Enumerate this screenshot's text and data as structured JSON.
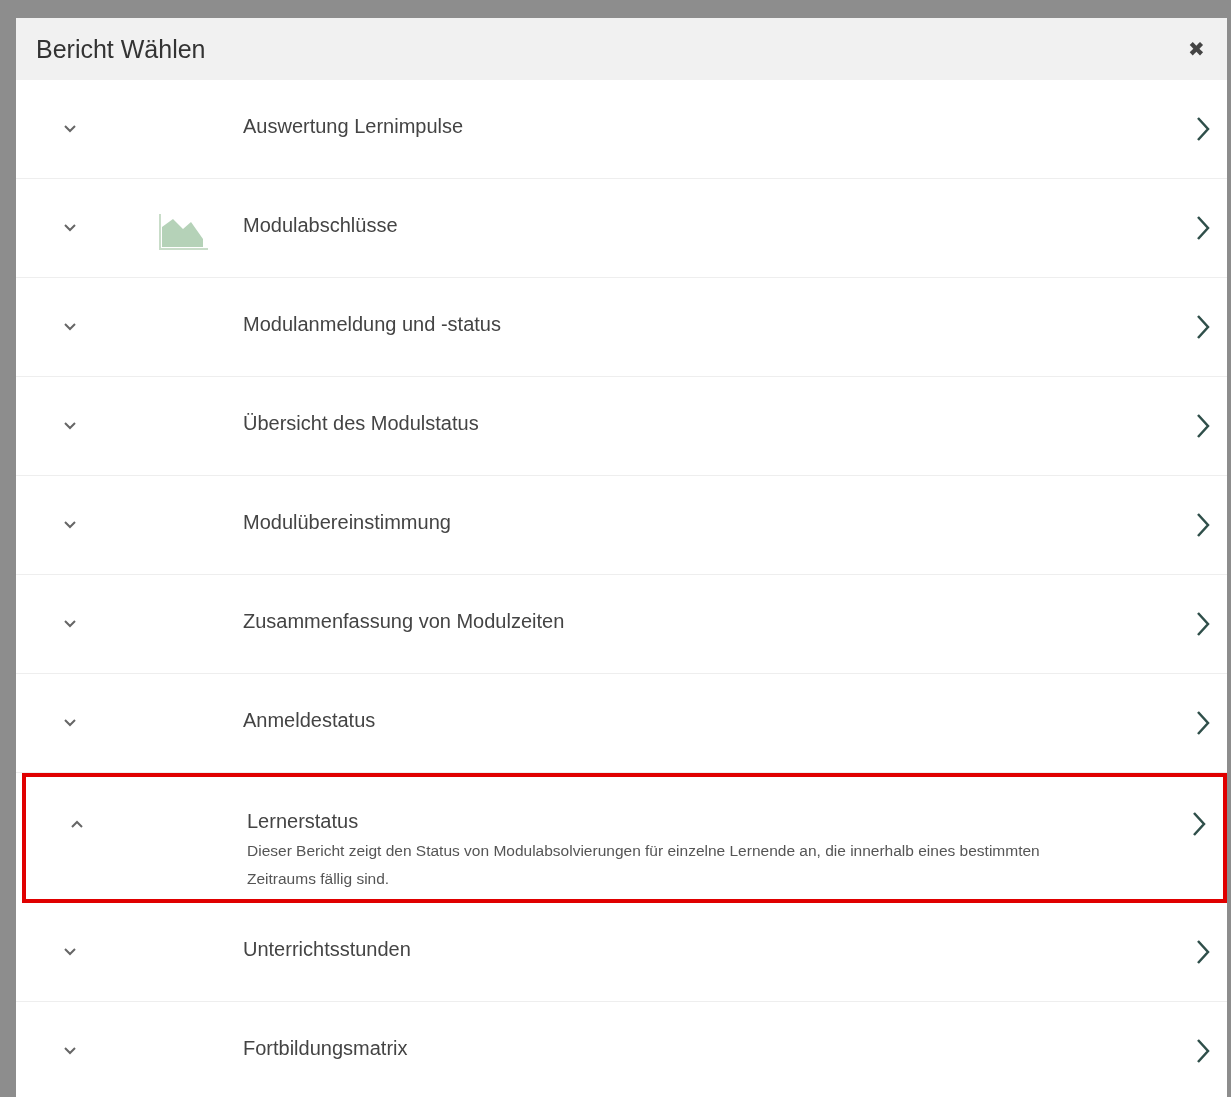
{
  "dialog": {
    "title": "Bericht Wählen",
    "close": "✖"
  },
  "reports": [
    {
      "title": "Auswertung Lernimpulse",
      "expanded": false,
      "highlighted": false
    },
    {
      "title": "Modulabschlüsse",
      "expanded": false,
      "highlighted": false,
      "kind": "chart"
    },
    {
      "title": "Modulanmeldung und -status",
      "expanded": false,
      "highlighted": false
    },
    {
      "title": "Übersicht des Modulstatus",
      "expanded": false,
      "highlighted": false
    },
    {
      "title": "Modulübereinstimmung",
      "expanded": false,
      "highlighted": false
    },
    {
      "title": "Zusammenfassung von Modulzeiten",
      "expanded": false,
      "highlighted": false
    },
    {
      "title": "Anmeldestatus",
      "expanded": false,
      "highlighted": false
    },
    {
      "title": "Lernerstatus",
      "expanded": true,
      "highlighted": true,
      "description": "Dieser Bericht zeigt den Status von Modulabsolvierungen für einzelne Lernende an, die innerhalb eines bestimmten Zeitraums fällig sind."
    },
    {
      "title": "Unterrichtsstunden",
      "expanded": false,
      "highlighted": false
    },
    {
      "title": "Fortbildungsmatrix",
      "expanded": false,
      "highlighted": false
    }
  ]
}
